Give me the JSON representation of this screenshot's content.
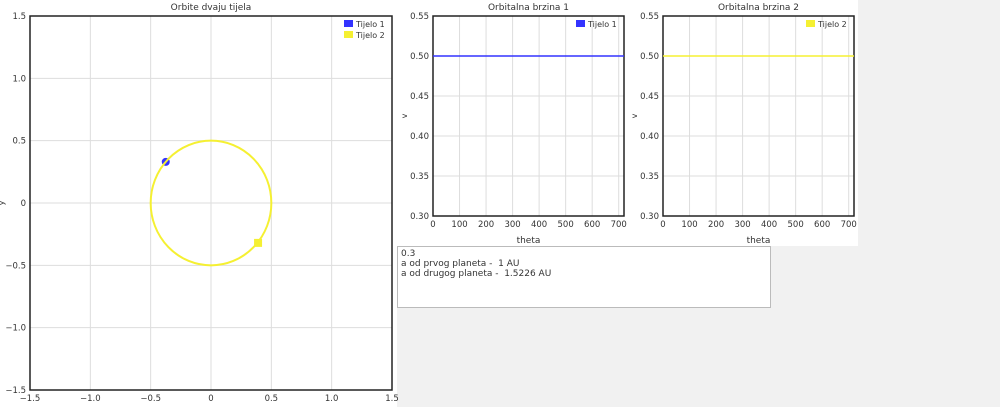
{
  "chart_data": [
    {
      "type": "scatter",
      "title": "Orbite dvaju tijela",
      "xlabel": "",
      "ylabel": "y",
      "xlim": [
        -1.5,
        1.5
      ],
      "ylim": [
        -1.5,
        1.5
      ],
      "xticks": [
        -1.5,
        -1.0,
        -0.5,
        0,
        0.5,
        1.0,
        1.5
      ],
      "yticks": [
        -1.5,
        -1.0,
        -0.5,
        0,
        0.5,
        1.0,
        1.5
      ],
      "xtick_labels": [
        "−1.5",
        "−1.0",
        "−0.5",
        "0",
        "0.5",
        "1.0",
        "1.5"
      ],
      "ytick_labels": [
        "−1.5",
        "−1.0",
        "−0.5",
        "0",
        "0.5",
        "1.0",
        "1.5"
      ],
      "grid": true,
      "legend": "top-right",
      "series": [
        {
          "name": "Tijelo 1",
          "color": "#3333ff",
          "marker": "circle",
          "points": [
            [
              -0.375,
              0.33
            ]
          ]
        },
        {
          "name": "Tijelo 2",
          "color": "#f5f032",
          "orbit_radius": 0.5,
          "marker": "square",
          "points": [
            [
              0.39,
              -0.32
            ]
          ]
        }
      ]
    },
    {
      "type": "line",
      "title": "Orbitalna brzina 1",
      "xlabel": "theta",
      "ylabel": "v",
      "xlim": [
        0,
        720
      ],
      "ylim": [
        0.3,
        0.55
      ],
      "xticks": [
        0,
        100,
        200,
        300,
        400,
        500,
        600,
        700
      ],
      "yticks": [
        0.3,
        0.35,
        0.4,
        0.45,
        0.5,
        0.55
      ],
      "xtick_labels": [
        "0",
        "100",
        "200",
        "300",
        "400",
        "500",
        "600",
        "700"
      ],
      "ytick_labels": [
        "0.30",
        "0.35",
        "0.40",
        "0.45",
        "0.50",
        "0.55"
      ],
      "grid": true,
      "legend": "top-right",
      "series": [
        {
          "name": "Tijelo 1",
          "color": "#3333ff",
          "x": [
            0,
            720
          ],
          "y": [
            0.5,
            0.5
          ]
        }
      ]
    },
    {
      "type": "line",
      "title": "Orbitalna brzina 2",
      "xlabel": "theta",
      "ylabel": "v",
      "xlim": [
        0,
        720
      ],
      "ylim": [
        0.3,
        0.55
      ],
      "xticks": [
        0,
        100,
        200,
        300,
        400,
        500,
        600,
        700
      ],
      "yticks": [
        0.3,
        0.35,
        0.4,
        0.45,
        0.5,
        0.55
      ],
      "xtick_labels": [
        "0",
        "100",
        "200",
        "300",
        "400",
        "500",
        "600",
        "700"
      ],
      "ytick_labels": [
        "0.30",
        "0.35",
        "0.40",
        "0.45",
        "0.50",
        "0.55"
      ],
      "grid": true,
      "legend": "top-right",
      "series": [
        {
          "name": "Tijelo 2",
          "color": "#f5f032",
          "x": [
            0,
            720
          ],
          "y": [
            0.5,
            0.5
          ]
        }
      ]
    }
  ],
  "info": {
    "lines": [
      "0.3",
      "a od prvog planeta -  1 AU",
      "a od drugog planeta -  1.5226 AU"
    ]
  }
}
